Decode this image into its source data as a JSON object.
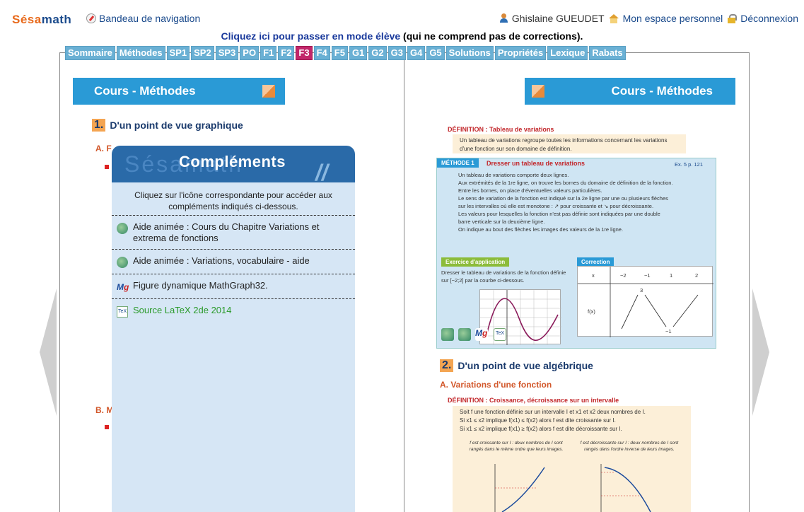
{
  "topbar": {
    "logo_part1": "Sésa",
    "logo_part2": "math",
    "nav_link": "Bandeau de navigation",
    "user_name": "Ghislaine GUEUDET",
    "personal_space": "Mon espace personnel",
    "logout": "Déconnexion"
  },
  "student_mode": {
    "link": "Cliquez ici pour passer en mode élève",
    "rest": " (qui ne comprend pas de corrections)."
  },
  "tabs": [
    {
      "label": "Sommaire",
      "active": false
    },
    {
      "label": "Méthodes",
      "active": false
    },
    {
      "label": "SP1",
      "active": false
    },
    {
      "label": "SP2",
      "active": false
    },
    {
      "label": "SP3",
      "active": false
    },
    {
      "label": "PO",
      "active": false
    },
    {
      "label": "F1",
      "active": false
    },
    {
      "label": "F2",
      "active": false
    },
    {
      "label": "F3",
      "active": true
    },
    {
      "label": "F4",
      "active": false
    },
    {
      "label": "F5",
      "active": false
    },
    {
      "label": "G1",
      "active": false
    },
    {
      "label": "G2",
      "active": false
    },
    {
      "label": "G3",
      "active": false
    },
    {
      "label": "G4",
      "active": false
    },
    {
      "label": "G5",
      "active": false
    },
    {
      "label": "Solutions",
      "active": false
    },
    {
      "label": "Propriétés",
      "active": false
    },
    {
      "label": "Lexique",
      "active": false
    },
    {
      "label": "Rabats",
      "active": false
    }
  ],
  "left_page": {
    "header": "Cours - Méthodes",
    "section1_num": "1.",
    "section1_title": "D'un point de vue graphique",
    "subA": "A. F",
    "subB": "B. M"
  },
  "right_page": {
    "header": "Cours - Méthodes",
    "def1_title": "DÉFINITION : Tableau de variations",
    "def1_text": "Un tableau de variations regroupe toutes les informations concernant les variations d'une fonction sur son domaine de définition.",
    "method_tag": "MÉTHODE 1",
    "method_title": "Dresser un tableau de variations",
    "method_ref": "Ex. 5 p. 121",
    "method_lines": [
      "Un tableau de variations comporte deux lignes.",
      "Aux extrémités de la 1re ligne, on trouve les bornes du domaine de définition de la fonction.",
      "Entre les bornes, on place d'éventuelles valeurs particulières.",
      "Le sens de variation de la fonction est indiqué sur la 2e ligne par une ou plusieurs flèches",
      "sur les intervalles où elle est monotone : ↗ pour croissante et ↘ pour décroissante.",
      "Les valeurs pour lesquelles la fonction n'est pas définie sont indiquées par une double",
      "barre verticale sur la deuxième ligne.",
      "On indique au bout des flèches les images des valeurs de la 1re ligne."
    ],
    "exercise_tag": "Exercice d'application",
    "exercise_text": "Dresser le tableau de variations de la fonction définie sur [−2;2] par la courbe ci-dessous.",
    "correction_tag": "Correction",
    "table_x_label": "x",
    "table_fx_label": "f(x)",
    "table_x_values": [
      "−2",
      "−1",
      "1",
      "2"
    ],
    "table_values": [
      "3",
      "−1"
    ],
    "section2_num": "2.",
    "section2_title": "D'un point de vue algébrique",
    "subA2": "A. Variations d'une fonction",
    "def2_title": "DÉFINITION : Croissance, décroissance sur un intervalle",
    "def2_lines": [
      "Soit f une fonction définie sur un intervalle I et x1 et x2 deux nombres de I.",
      "Si x1 ≤ x2 implique f(x1) ≤ f(x2) alors f est dite croissante sur I.",
      "Si x1 ≤ x2 implique f(x1) ≥ f(x2) alors f est dite décroissante sur I."
    ],
    "cap_left": "f est croissante sur I : deux nombres de I sont rangés dans le même ordre que leurs images.",
    "cap_right": "f est décroissante sur I : deux nombres de I sont rangés dans l'ordre inverse de leurs images."
  },
  "popup": {
    "watermark": "Sésamath",
    "title": "Compléments",
    "intro": "Cliquez sur l'icône correspondante pour accéder aux compléments indiqués ci-dessous.",
    "items": [
      {
        "label": "Aide animée : Cours du Chapitre Variations et extrema de fonctions",
        "icon": "animation-icon"
      },
      {
        "label": "Aide animée : Variations, vocabulaire - aide",
        "icon": "animation-icon"
      },
      {
        "label": "Figure dynamique MathGraph32.",
        "icon": "mathgraph-icon"
      },
      {
        "label": "Source LaTeX 2de 2014",
        "icon": "tex-icon"
      }
    ]
  },
  "colors": {
    "accent_blue": "#2a9ad6",
    "popup_blue": "#2a6aa8",
    "active_tab": "#c2266a",
    "tab": "#6ab0d4",
    "link": "#1a4a8c"
  }
}
